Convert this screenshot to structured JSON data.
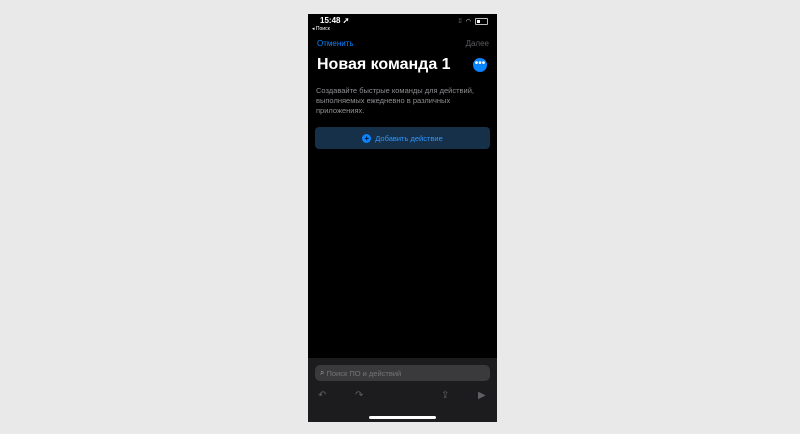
{
  "status_bar": {
    "time": "15:48 ➚",
    "back_app": "◂ Поиск",
    "signal": "⁞⁞",
    "wifi": "◠"
  },
  "nav": {
    "cancel_label": "Отменить",
    "next_label": "Далее"
  },
  "shortcut": {
    "title": "Новая команда 1",
    "description": "Создавайте быстрые команды для действий, выполняемых ежедневно в различных приложениях.",
    "add_action_label": "Добавить действие"
  },
  "search": {
    "placeholder": "Поиск ПО и действий",
    "value": ""
  },
  "toolbar": {
    "icons": [
      "undo-icon",
      "redo-icon",
      "share-icon",
      "play-icon"
    ]
  },
  "colors": {
    "accent": "#0a84ff",
    "background": "#000000",
    "panel": "#1c1c1e"
  }
}
